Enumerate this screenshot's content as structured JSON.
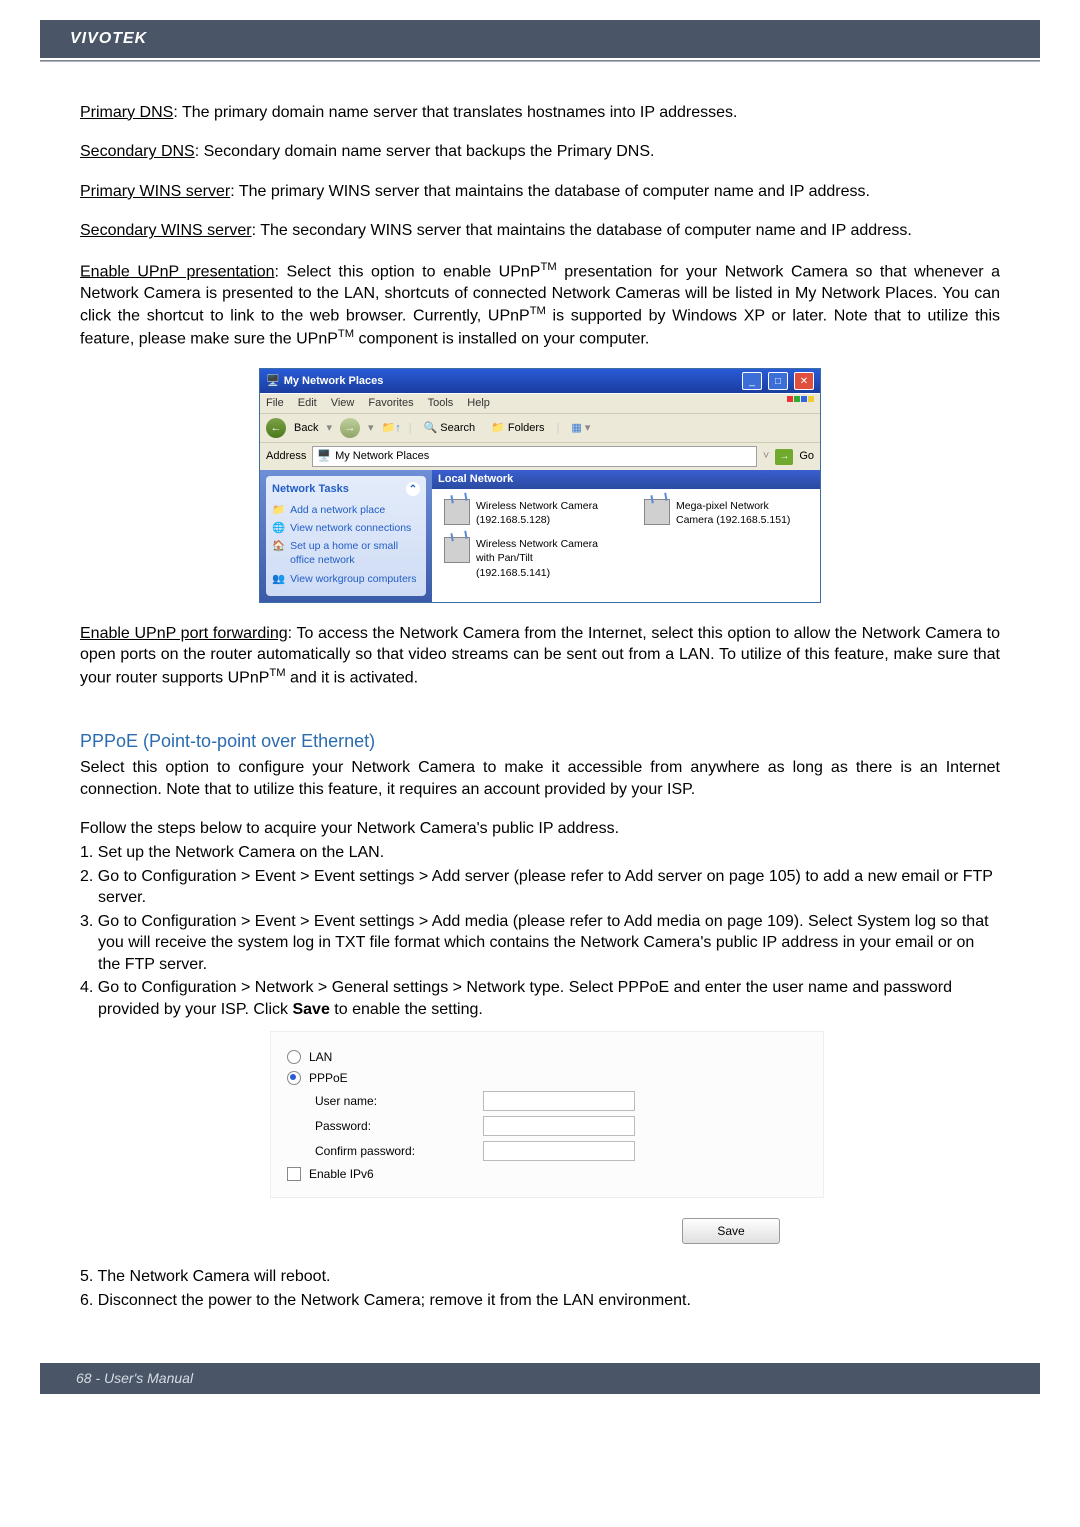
{
  "header": {
    "brand": "VIVOTEK"
  },
  "footer": {
    "text": "68 - User's Manual"
  },
  "paragraphs": {
    "p1_term": "Primary DNS",
    "p1_text": ": The primary domain name server that translates hostnames into IP addresses.",
    "p2_term": "Secondary DNS",
    "p2_text": ": Secondary domain name server that backups the Primary DNS.",
    "p3_term": "Primary WINS server",
    "p3_text": ": The primary WINS server that maintains the database of computer name and IP address.",
    "p4_term": "Secondary WINS server",
    "p4_text": ": The secondary WINS server that maintains the database of computer name and IP address.",
    "p5_term": "Enable UPnP presentation",
    "p5_a": ": Select this option to enable UPnP",
    "p5_b": " presentation for your Network Camera so that whenever a Network Camera is presented to the LAN, shortcuts of connected Network Cameras will be listed in My Network Places. You can click the shortcut to link to the web browser. Currently, UPnP",
    "p5_c": " is supported by Windows XP or later. Note that to utilize this feature, please make sure the UPnP",
    "p5_d": " component is installed on your computer.",
    "tm": "TM",
    "p6_term": "Enable UPnP port forwarding",
    "p6_a": ": To access the Network Camera from the Internet, select this option to allow the Network Camera to open ports on the router automatically so that video streams can be sent out from a LAN. To utilize of this feature, make sure that your router supports UPnP",
    "p6_b": " and it is activated."
  },
  "pppoe": {
    "title": "PPPoE (Point-to-point over Ethernet)",
    "intro": "Select this option to configure your Network Camera to make it accessible from anywhere as long as there is an Internet connection. Note that to utilize this feature, it requires an account provided by your ISP.",
    "follow": "Follow the steps below to acquire your Network Camera's public IP address.",
    "step1": "1. Set up the Network Camera on the LAN.",
    "step2": "2. Go to Configuration > Event > Event settings > Add server (please refer to Add server on page 105) to add a new email or FTP server.",
    "step3": "3. Go to Configuration > Event > Event settings > Add media (please refer to Add media on page 109). Select System log so that you will receive the system log in TXT file format which contains the Network Camera's public IP address in your email or on the FTP server.",
    "step4a": "4. Go to Configuration > Network > General settings > Network type. Select PPPoE and enter the user name and password provided by your ISP. Click ",
    "step4b": "Save",
    "step4c": " to enable the setting.",
    "step5": "5. The Network Camera will reboot.",
    "step6": "6. Disconnect the power to the Network Camera; remove it from the LAN environment."
  },
  "winxp": {
    "title": "My Network Places",
    "menu": [
      "File",
      "Edit",
      "View",
      "Favorites",
      "Tools",
      "Help"
    ],
    "toolbar": {
      "back": "Back",
      "search": "Search",
      "folders": "Folders"
    },
    "address_label": "Address",
    "address_value": "My Network Places",
    "go": "Go",
    "tasks_header": "Network Tasks",
    "tasks": [
      "Add a network place",
      "View network connections",
      "Set up a home or small office network",
      "View workgroup computers"
    ],
    "section": "Local Network",
    "items": [
      {
        "name": "Wireless Network Camera (192.168.5.128)",
        "sub": ""
      },
      {
        "name": "Mega-pixel Network Camera (192.168.5.151)",
        "sub": ""
      },
      {
        "name": "Wireless Network Camera with Pan/Tilt (192.168.5.141)",
        "sub": ""
      }
    ]
  },
  "form": {
    "lan": "LAN",
    "pppoe": "PPPoE",
    "user": "User name:",
    "pass": "Password:",
    "confirm": "Confirm password:",
    "ipv6": "Enable IPv6",
    "save": "Save"
  }
}
